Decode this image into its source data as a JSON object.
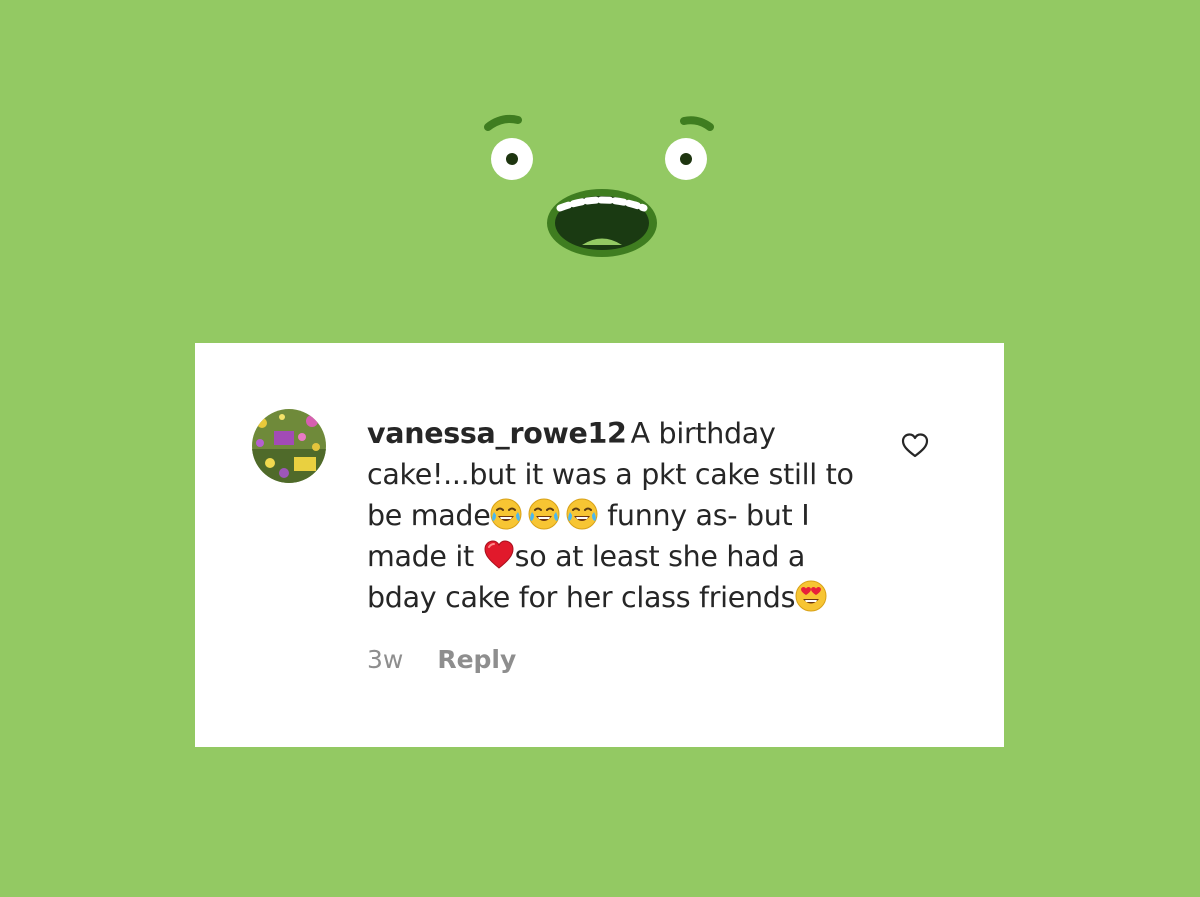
{
  "colors": {
    "background": "#93c963",
    "card": "#ffffff",
    "text": "#262626",
    "muted": "#8e8e8e"
  },
  "comment": {
    "username": "vanessa_rowe12",
    "text_part1": "A birthday cake!...but it was a pkt cake still to be made",
    "text_part2": " funny as- but I made it ",
    "text_part3": "so at least she had a bday cake for her class friends",
    "emojis": [
      "face-with-tears-of-joy",
      "face-with-tears-of-joy",
      "face-with-tears-of-joy",
      "red-heart",
      "smiling-face-with-heart-eyes"
    ],
    "time": "3w",
    "reply_label": "Reply",
    "like_icon": "heart-outline-icon"
  }
}
